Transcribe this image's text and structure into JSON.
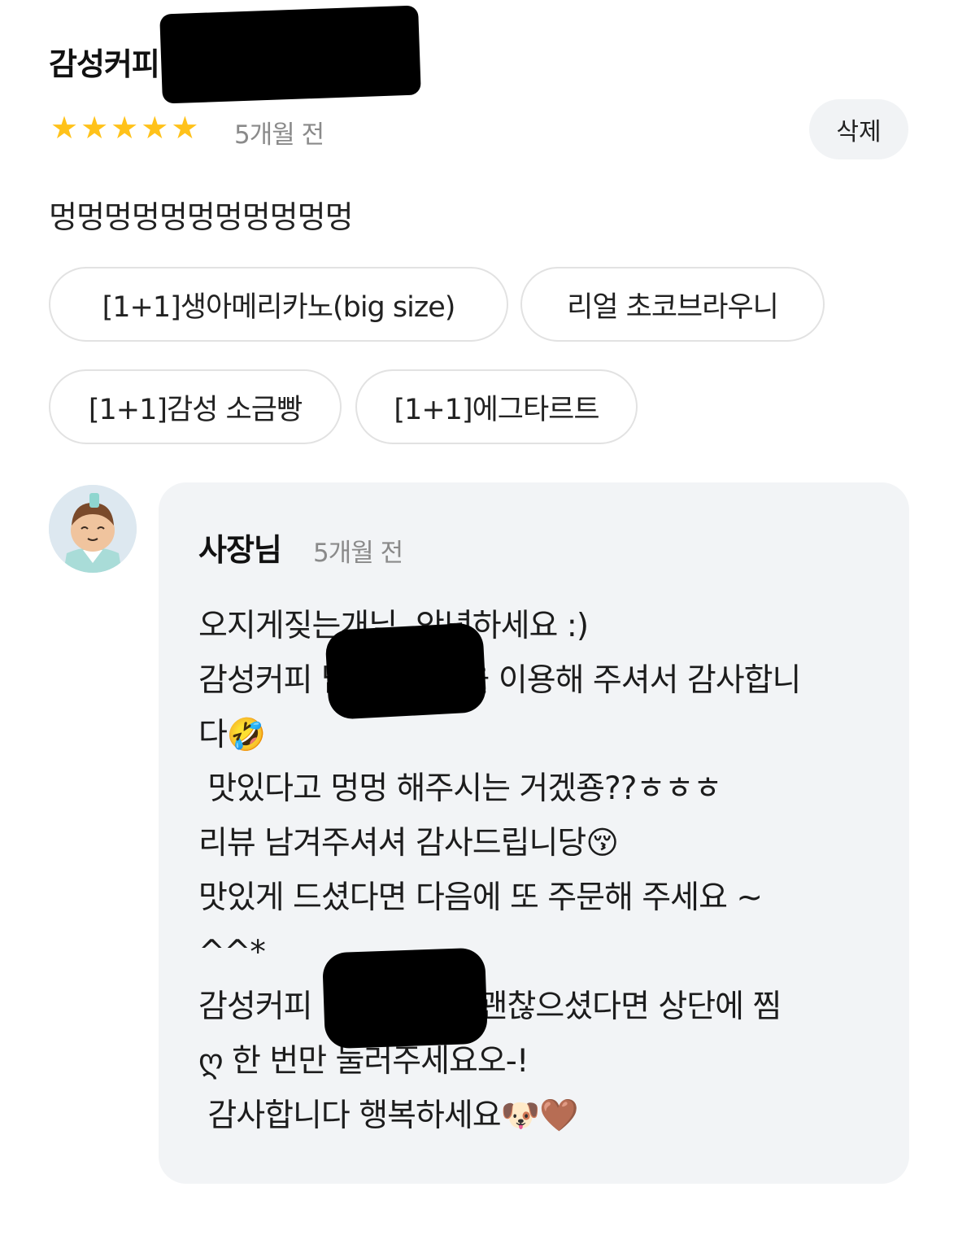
{
  "review": {
    "store_name": "감성커피",
    "rating": 5,
    "rating_max": 5,
    "time": "5개월 전",
    "delete_label": "삭제",
    "text": "멍멍멍멍멍멍멍멍멍멍멍",
    "menu_tags": [
      "[1+1]생아메리카노(big size)",
      "리얼 초코브라우니",
      "[1+1]감성 소금빵",
      "[1+1]에그타르트"
    ],
    "star_color": "#ffc21a"
  },
  "reply": {
    "author": "사장님",
    "time": "5개월 전",
    "lines": [
      "오지게짖는개님  안녕하세요 :)",
      "감성커피 남            을 이용해 주셔서 감사합니",
      "다🤣",
      " 맛있다고 멍멍 해주시는 거겠죵??ㅎㅎㅎ",
      "리뷰 남겨주셔셔 감사드립니당😚",
      "맛있게 드셨다면 다음에 또 주문해 주세요 ~",
      "^^*",
      "감성커피                  괜찮으셨다면 상단에 찜",
      "ღ 한 번만 눌러주세요오-!",
      " 감사합니다 행복하세요🐶🤎"
    ],
    "background_color": "#f2f4f6"
  }
}
